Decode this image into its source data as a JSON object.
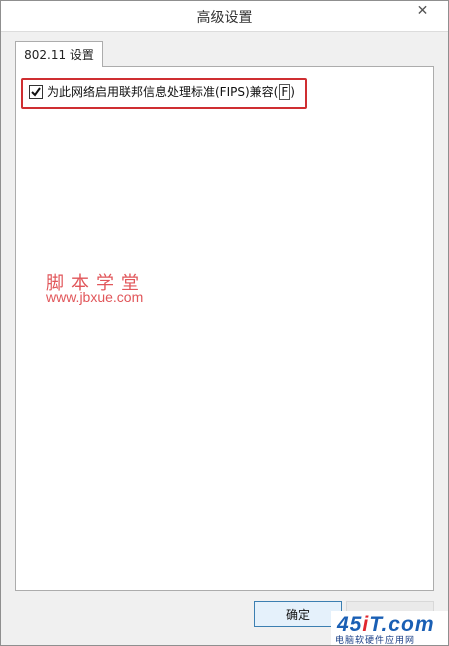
{
  "window": {
    "title": "高级设置",
    "close_glyph": "✕"
  },
  "tabs": [
    {
      "label": "802.11 设置",
      "active": true
    }
  ],
  "fips": {
    "checked": true,
    "label": "为此网络启用联邦信息处理标准(FIPS)兼容(",
    "accelerator": "F",
    "label_suffix": ")"
  },
  "watermark": {
    "title": "脚本学堂",
    "url": "www.jbxue.com"
  },
  "buttons": {
    "ok": "确定"
  },
  "logo": {
    "main_prefix": "45",
    "main_dot": "i",
    "main_suffix": "T.com",
    "sub": "电脑软硬件应用网"
  },
  "colors": {
    "highlight": "#cf2e31",
    "watermark": "#e1565a",
    "logo_blue": "#1a5fb4"
  },
  "icons": {
    "checkbox": "checkmark-icon",
    "close": "close-icon"
  }
}
